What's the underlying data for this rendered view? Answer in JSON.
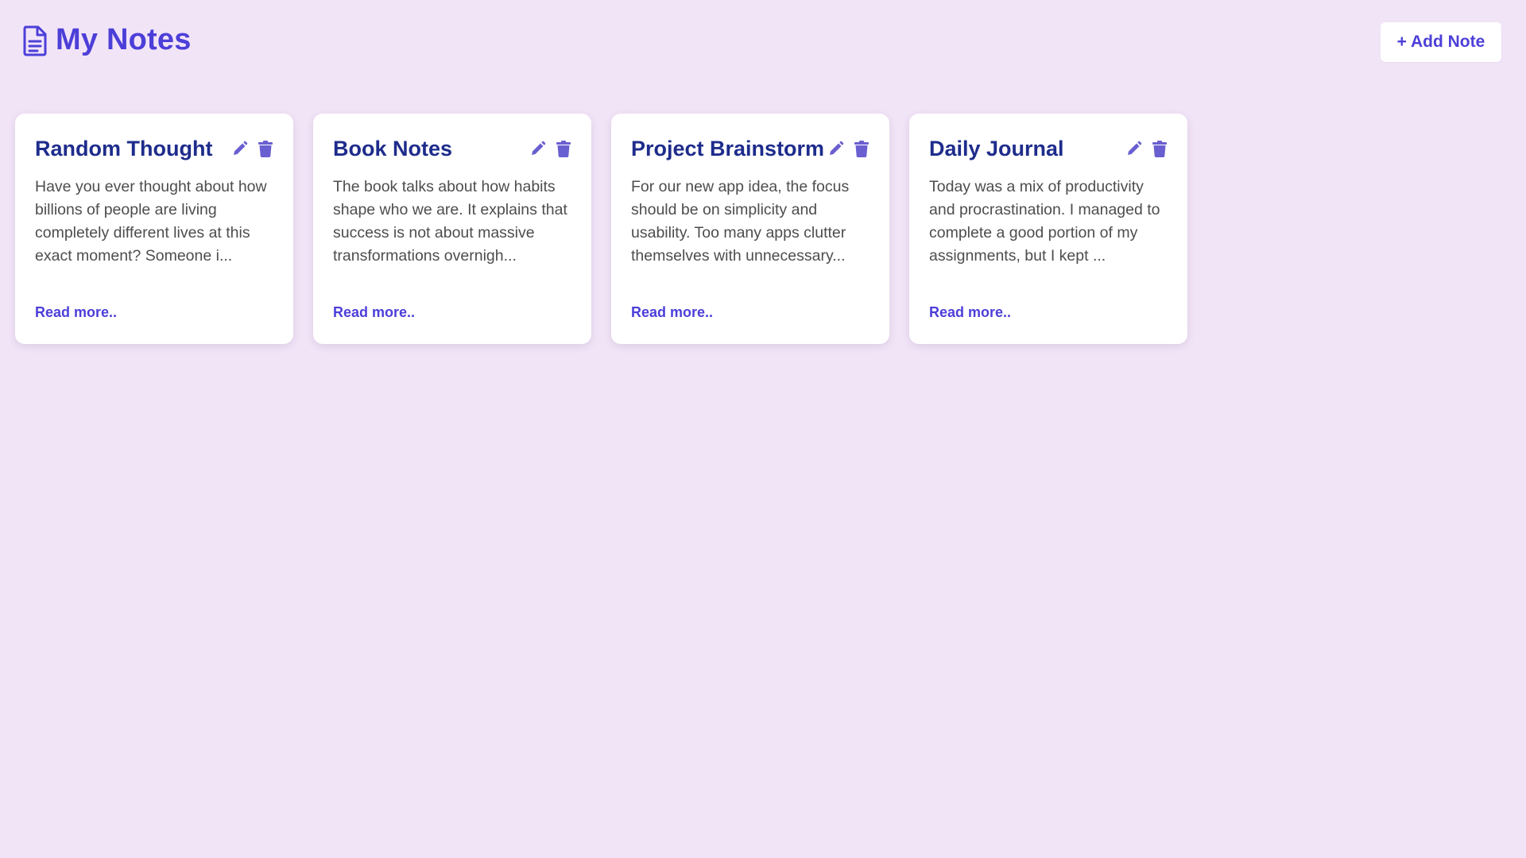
{
  "app": {
    "title": "My Notes",
    "add_button_label": "+ Add Note"
  },
  "notes": [
    {
      "title": "Random Thought",
      "excerpt": "Have you ever thought about how billions of people are living completely different lives at this exact moment? Someone i...",
      "read_more": "Read more.."
    },
    {
      "title": "Book Notes",
      "excerpt": "The book talks about how habits shape who we are. It explains that success is not about massive transformations overnigh...",
      "read_more": "Read more.."
    },
    {
      "title": "Project Brainstorm",
      "excerpt": "For our new app idea, the focus should be on simplicity and usability. Too many apps clutter themselves with unnecessary...",
      "read_more": "Read more.."
    },
    {
      "title": "Daily Journal",
      "excerpt": "Today was a mix of productivity and procrastination. I managed to complete a good portion of my assignments, but I kept ...",
      "read_more": "Read more.."
    }
  ],
  "icons": {
    "header": "document-icon",
    "edit": "pencil-icon",
    "delete": "trash-icon"
  },
  "colors": {
    "background": "#f2e4f7",
    "accent": "#4c3fd8",
    "note_title": "#1e2c8c",
    "icon": "#6a5fd0",
    "body_text": "#4d4d4d",
    "card": "#ffffff"
  }
}
